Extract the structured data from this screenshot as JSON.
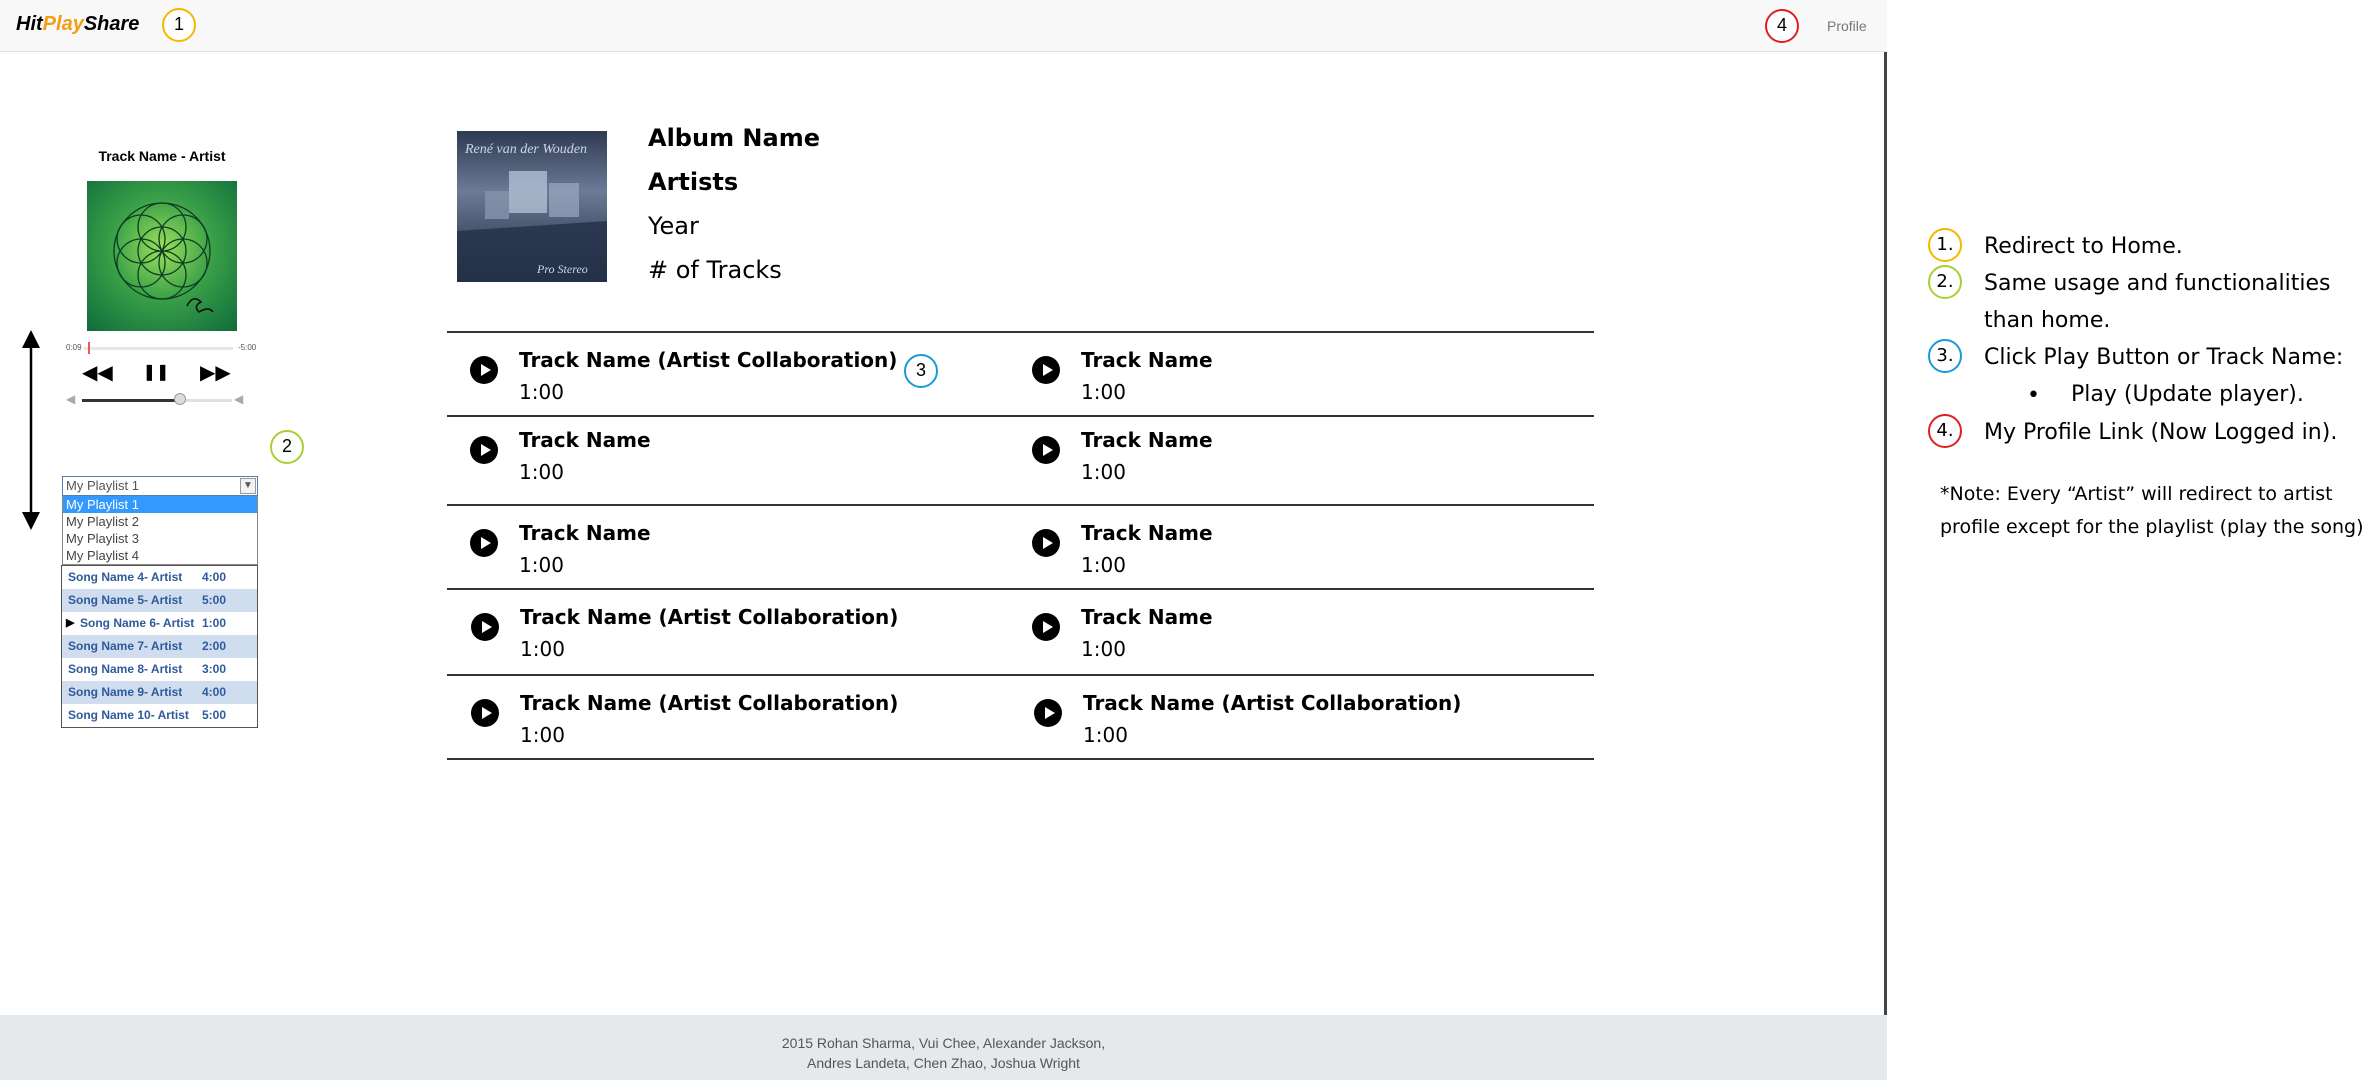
{
  "navbar": {
    "brand_hit": "Hit",
    "brand_play": "Play",
    "brand_share": "Share",
    "profile": "Profile",
    "marker_home": "1",
    "marker_profile": "4"
  },
  "player": {
    "title": "Track Name - Artist",
    "time_elapsed": "0:09",
    "time_remaining": "-5:00",
    "rewind_icon": "◀◀",
    "pause_icon": "❚❚",
    "forward_icon": "▶▶",
    "volume_level": 0.65,
    "marker": "2"
  },
  "playlist": {
    "selected": "My Playlist 1",
    "options": [
      "My Playlist 1",
      "My Playlist 2",
      "My Playlist 3",
      "My Playlist 4"
    ],
    "songs": [
      {
        "name": "Song Name 4- Artist",
        "duration": "4:00"
      },
      {
        "name": "Song Name 5- Artist",
        "duration": "5:00"
      },
      {
        "name": "Song Name 6- Artist",
        "duration": "1:00"
      },
      {
        "name": "Song Name 7- Artist",
        "duration": "2:00"
      },
      {
        "name": "Song Name 8- Artist",
        "duration": "3:00"
      },
      {
        "name": "Song Name 9- Artist",
        "duration": "4:00"
      },
      {
        "name": "Song Name 10- Artist",
        "duration": "5:00"
      }
    ]
  },
  "album": {
    "name": "Album Name",
    "artists": "Artists",
    "year": "Year",
    "track_count": "# of Tracks",
    "art_text_top": "René van der Wouden",
    "art_text_bottom": "Pro Stereo"
  },
  "tracks": {
    "marker": "3",
    "left": [
      {
        "name": "Track Name (Artist Collaboration)",
        "duration": "1:00"
      },
      {
        "name": "Track Name",
        "duration": "1:00"
      },
      {
        "name": "Track Name",
        "duration": "1:00"
      },
      {
        "name": "Track Name (Artist Collaboration)",
        "duration": "1:00"
      },
      {
        "name": "Track Name (Artist Collaboration)",
        "duration": "1:00"
      }
    ],
    "right": [
      {
        "name": "Track Name",
        "duration": "1:00"
      },
      {
        "name": "Track Name",
        "duration": "1:00"
      },
      {
        "name": "Track Name",
        "duration": "1:00"
      },
      {
        "name": "Track Name",
        "duration": "1:00"
      },
      {
        "name": "Track Name (Artist Collaboration)",
        "duration": "1:00"
      }
    ]
  },
  "footer": {
    "line1": "2015 Rohan Sharma, Vui Chee, Alexander Jackson,",
    "line2": "Andres Landeta, Chen Zhao, Joshua Wright"
  },
  "notes": {
    "items": [
      {
        "marker": "1.",
        "text": "Redirect to Home.",
        "color": "#f5b800"
      },
      {
        "marker": "2.",
        "text": "Same usage and functionalities",
        "text2": "than home.",
        "color": "#a8d032"
      },
      {
        "marker": "3.",
        "text": "Click Play Button or Track Name:",
        "color": "#1a9ad6"
      },
      {
        "marker": "4.",
        "text": "My Profile Link (Now Logged in).",
        "color": "#e02020"
      }
    ],
    "bullet_symbol": "•",
    "bullet": "Play (Update player).",
    "note_line1": "*Note: Every “Artist” will redirect to artist",
    "note_line2": "profile except for the playlist (play the song)"
  }
}
